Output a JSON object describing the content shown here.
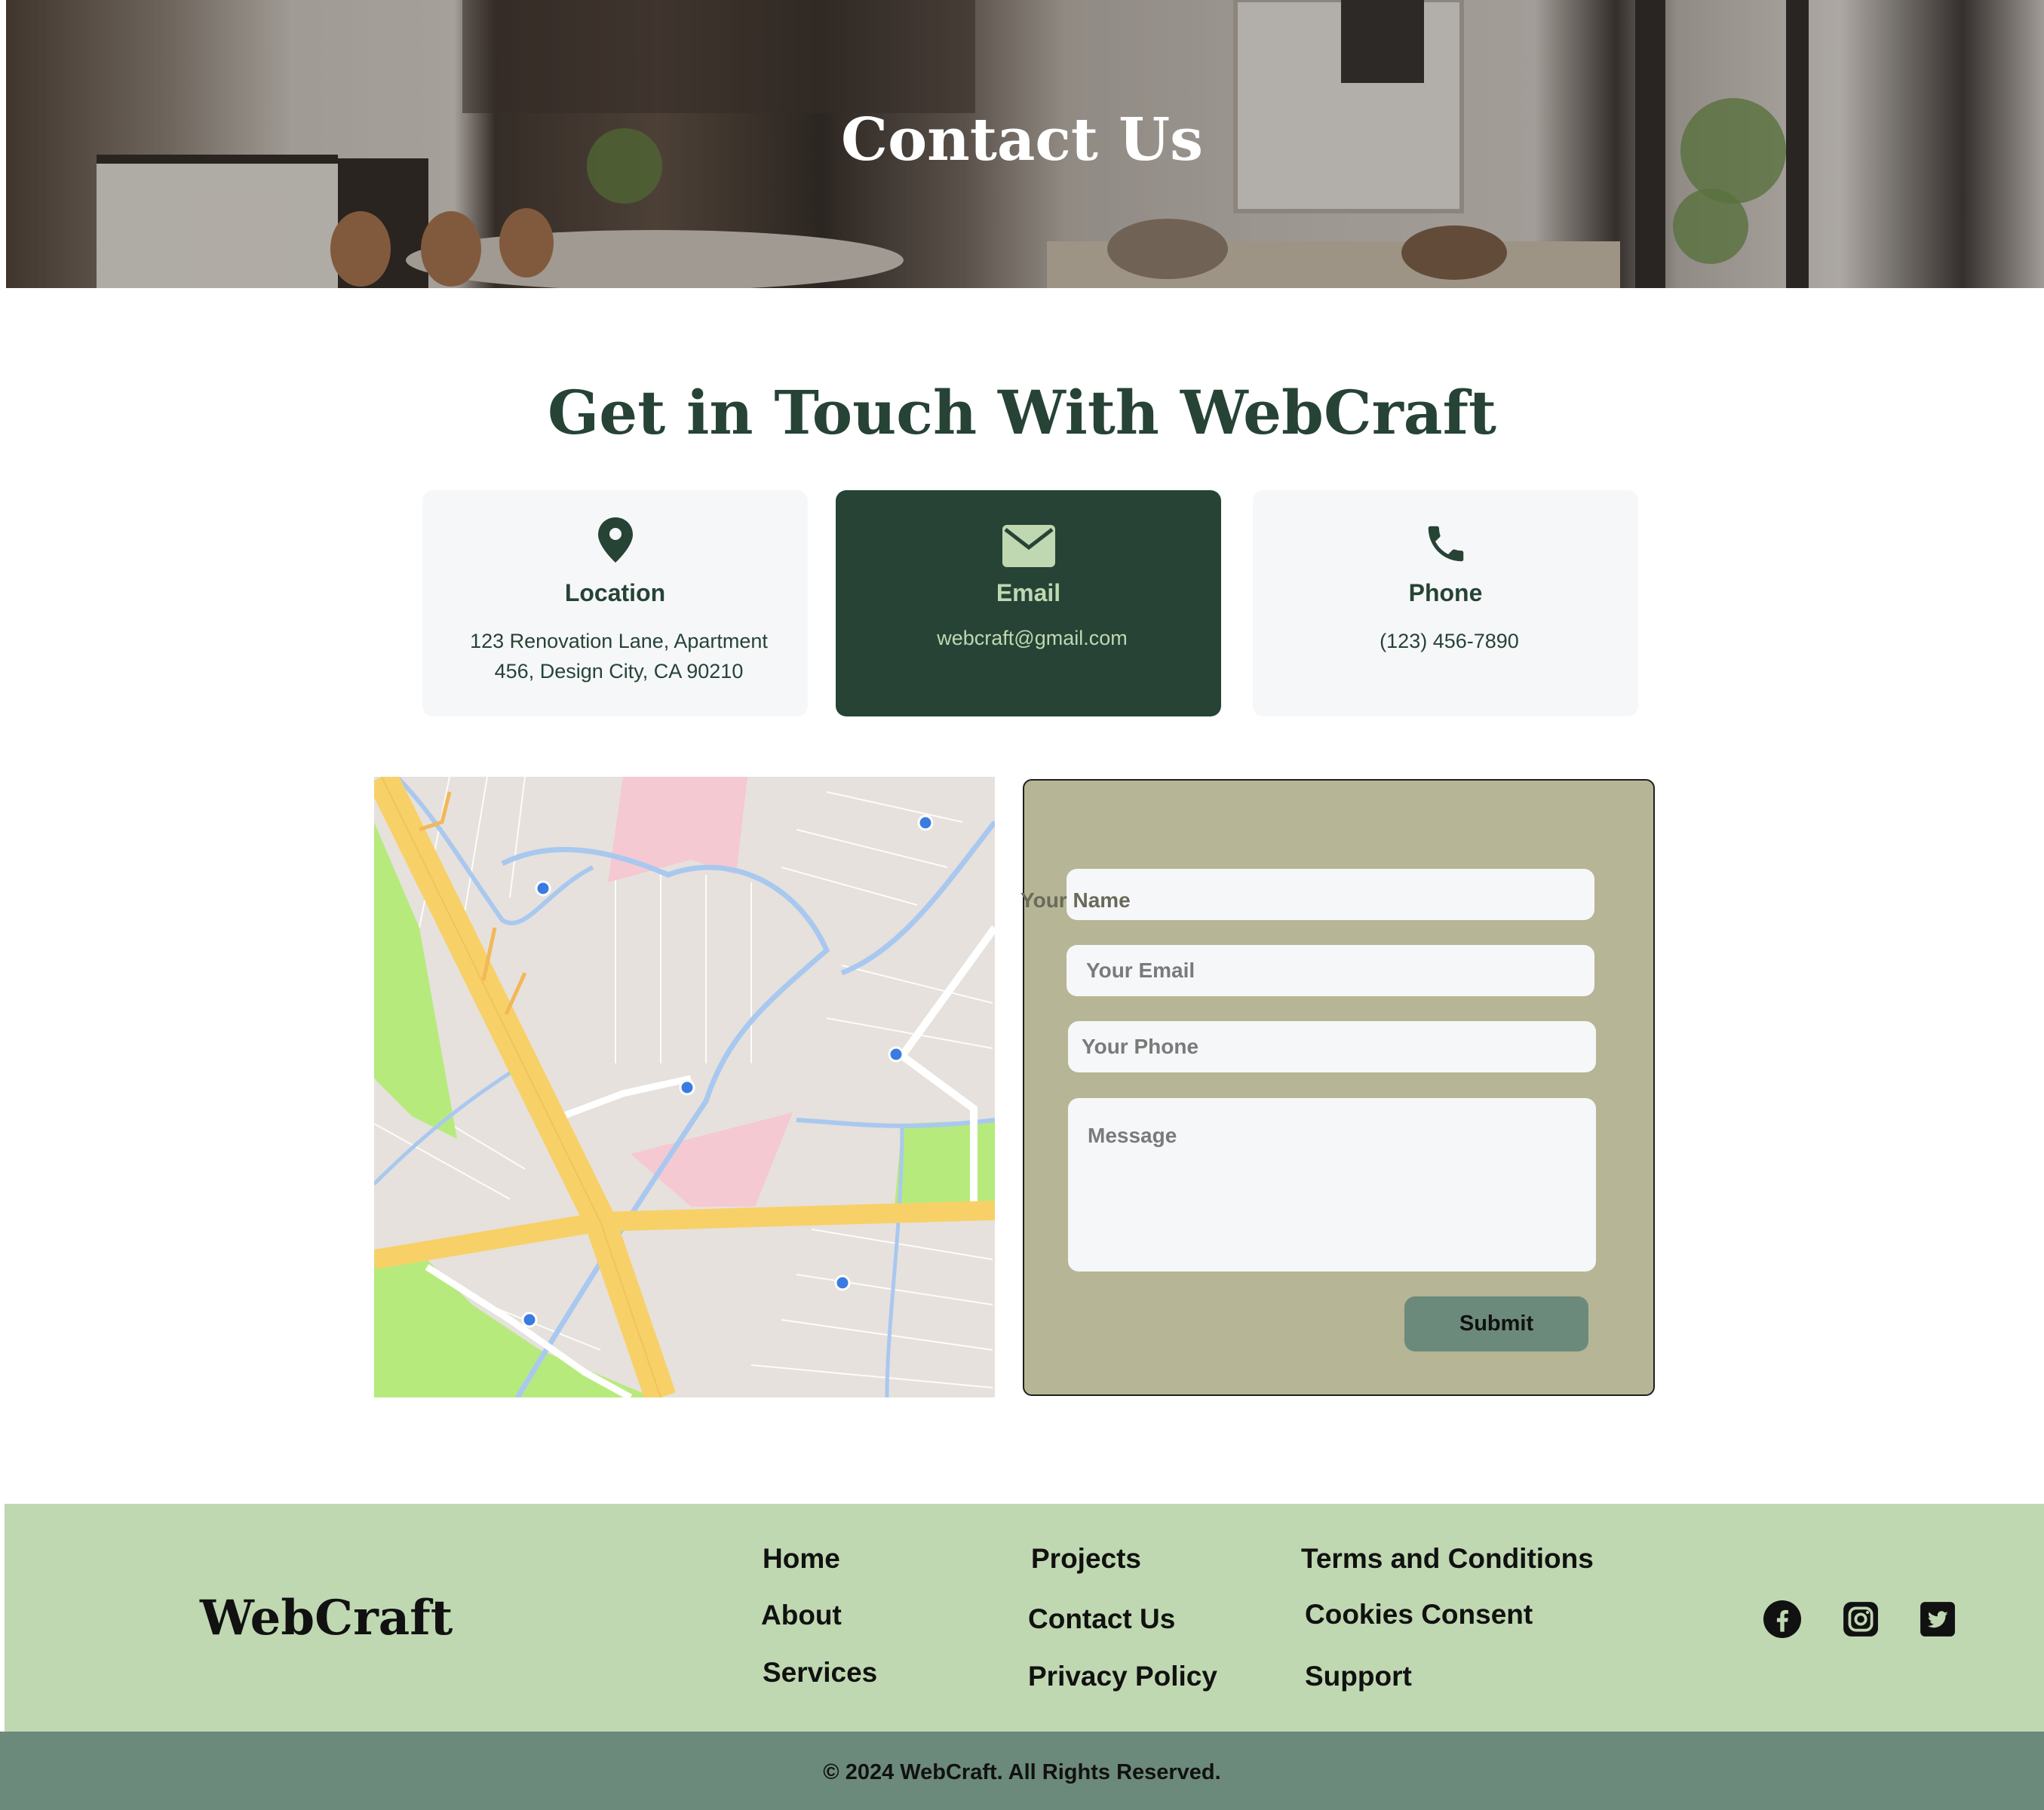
{
  "hero": {
    "title": "Contact Us"
  },
  "section": {
    "heading": "Get in Touch With WebCraft"
  },
  "cards": [
    {
      "icon": "location-pin-icon",
      "title": "Location",
      "text": "123 Renovation Lane, Apartment 456, Design City, CA 90210"
    },
    {
      "icon": "envelope-icon",
      "title": "Email",
      "text": "webcraft@gmail.com"
    },
    {
      "icon": "phone-icon",
      "title": "Phone",
      "text": "(123) 456-7890"
    }
  ],
  "form": {
    "name_label": "Your Name",
    "email_placeholder": "Your Email",
    "phone_placeholder": "Your Phone",
    "message_placeholder": "Message",
    "submit_label": "Submit"
  },
  "footer": {
    "brand": "WebCraft",
    "links": {
      "home": "Home",
      "about": "About",
      "services": "Services",
      "projects": "Projects",
      "contact": "Contact Us",
      "privacy": "Privacy Policy",
      "terms": "Terms and Conditions",
      "cookies": "Cookies Consent",
      "support": "Support"
    },
    "social": [
      "facebook-icon",
      "instagram-icon",
      "twitter-icon"
    ],
    "copyright": "© 2024 WebCraft. All Rights Reserved."
  },
  "colors": {
    "primary_dark": "#264336",
    "accent_light": "#bfd8b1",
    "form_bg": "#b6b595",
    "button_bg": "#6c8a7b"
  }
}
